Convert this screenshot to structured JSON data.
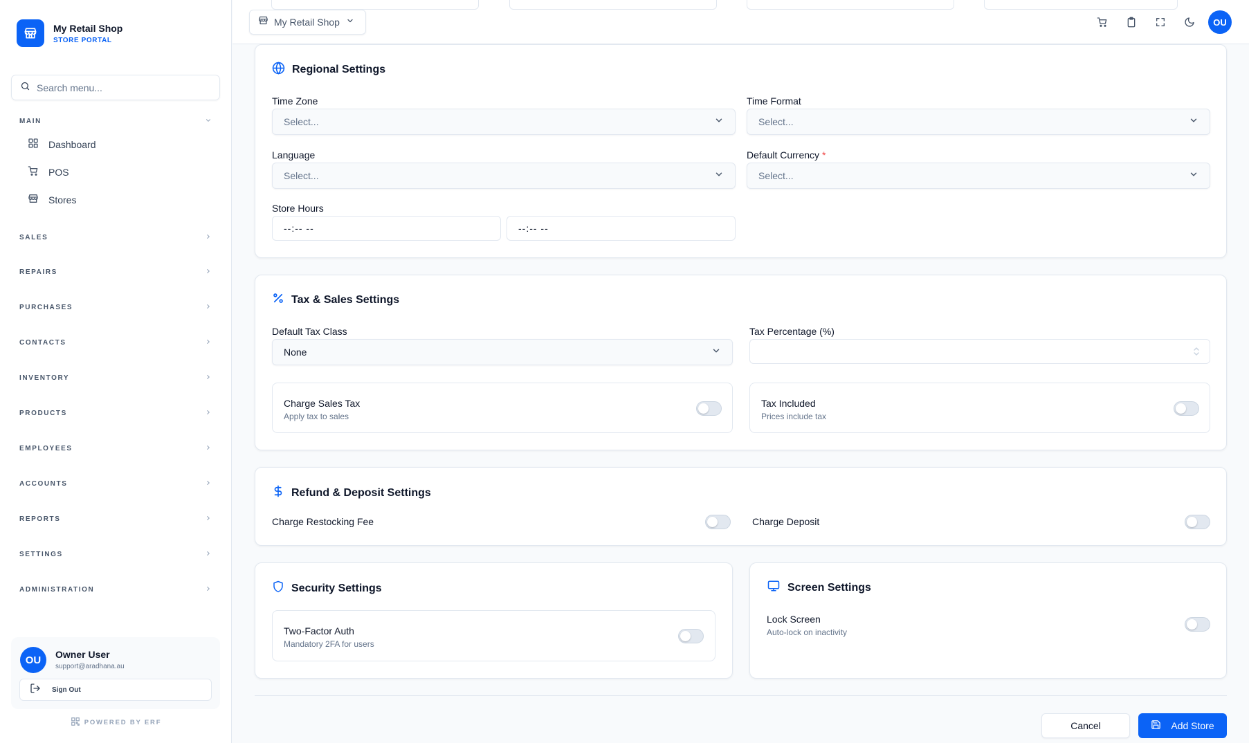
{
  "colors": {
    "accent": "#0b63f6",
    "required": "#ef4444"
  },
  "brand": {
    "name": "My Retail Shop",
    "subtitle": "STORE PORTAL"
  },
  "search": {
    "placeholder": "Search menu..."
  },
  "nav": {
    "main_label": "MAIN",
    "main_items": [
      {
        "label": "Dashboard",
        "icon": "grid-icon"
      },
      {
        "label": "POS",
        "icon": "cart-icon"
      },
      {
        "label": "Stores",
        "icon": "store-icon"
      }
    ],
    "groups": [
      "SALES",
      "REPAIRS",
      "PURCHASES",
      "CONTACTS",
      "INVENTORY",
      "PRODUCTS",
      "EMPLOYEES",
      "ACCOUNTS",
      "REPORTS",
      "SETTINGS",
      "ADMINISTRATION"
    ]
  },
  "user": {
    "initials": "OU",
    "name": "Owner User",
    "email": "support@aradhana.au",
    "sign_out": "Sign Out"
  },
  "powered_by": "POWERED BY ERF",
  "header": {
    "shop_selector": "My Retail Shop",
    "avatar": "OU"
  },
  "regional": {
    "title": "Regional Settings",
    "time_zone_label": "Time Zone",
    "time_zone_value": "Select...",
    "time_format_label": "Time Format",
    "time_format_value": "Select...",
    "language_label": "Language",
    "language_value": "Select...",
    "currency_label": "Default Currency",
    "currency_required": "*",
    "currency_value": "Select...",
    "store_hours_label": "Store Hours",
    "open_time": "--:-- --",
    "close_time": "--:-- --"
  },
  "tax": {
    "title": "Tax & Sales Settings",
    "tax_class_label": "Default Tax Class",
    "tax_class_value": "None",
    "tax_pct_label": "Tax Percentage (%)",
    "tax_pct_value": "",
    "charge_tax_title": "Charge Sales Tax",
    "charge_tax_sub": "Apply tax to sales",
    "charge_tax_on": false,
    "tax_included_title": "Tax Included",
    "tax_included_sub": "Prices include tax",
    "tax_included_on": false
  },
  "refund": {
    "title": "Refund & Deposit Settings",
    "restocking_label": "Charge Restocking Fee",
    "restocking_on": false,
    "deposit_label": "Charge Deposit",
    "deposit_on": false
  },
  "security": {
    "title": "Security Settings",
    "twofa_title": "Two-Factor Auth",
    "twofa_sub": "Mandatory 2FA for users",
    "twofa_on": false
  },
  "screen": {
    "title": "Screen Settings",
    "lock_title": "Lock Screen",
    "lock_sub": "Auto-lock on inactivity",
    "lock_on": false
  },
  "actions": {
    "cancel": "Cancel",
    "submit": "Add Store"
  }
}
